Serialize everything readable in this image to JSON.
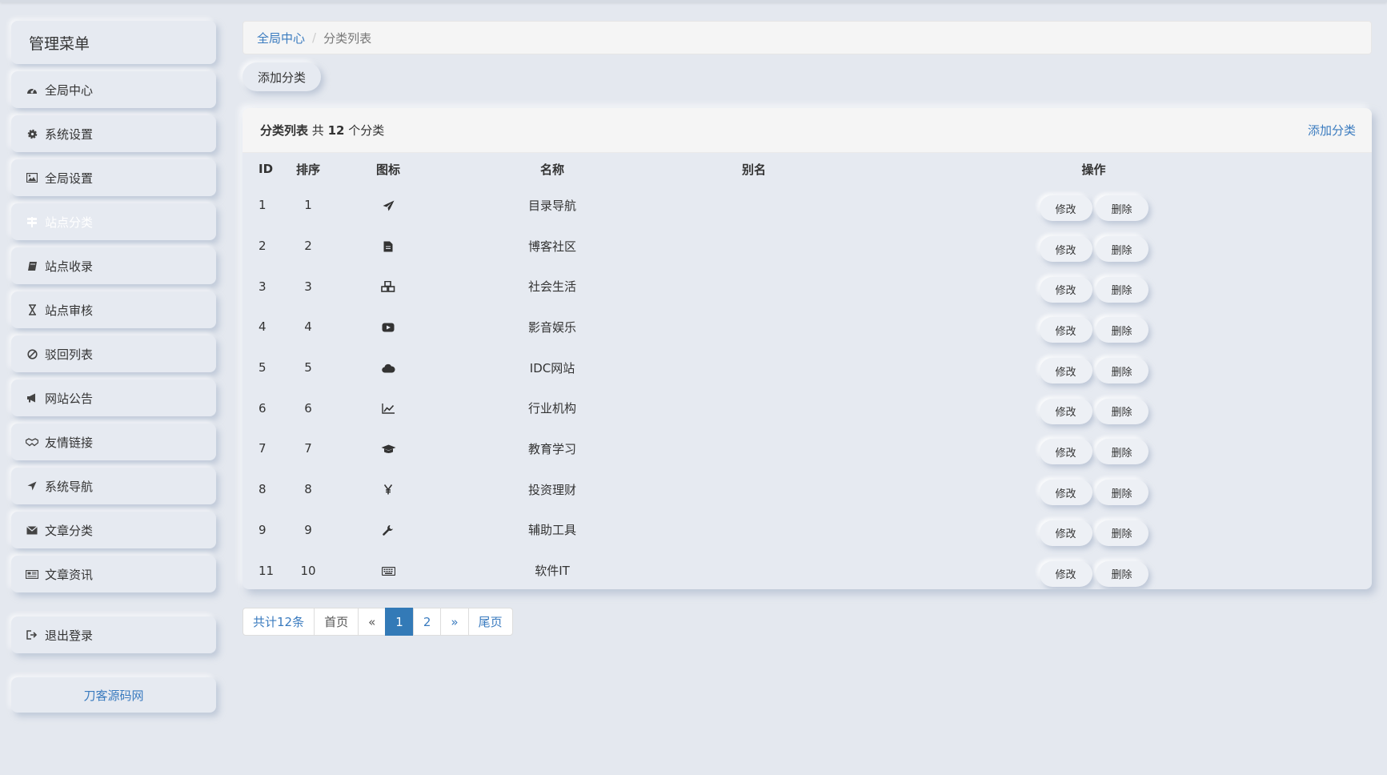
{
  "sidebar": {
    "title": "管理菜单",
    "items": [
      {
        "label": "全局中心",
        "icon": "dashboard-icon"
      },
      {
        "label": "系统设置",
        "icon": "gear-icon"
      },
      {
        "label": "全局设置",
        "icon": "image-icon"
      },
      {
        "label": "站点分类",
        "icon": "signpost-icon"
      },
      {
        "label": "站点收录",
        "icon": "book-icon"
      },
      {
        "label": "站点审核",
        "icon": "hourglass-icon"
      },
      {
        "label": "驳回列表",
        "icon": "ban-icon"
      },
      {
        "label": "网站公告",
        "icon": "bullhorn-icon"
      },
      {
        "label": "友情链接",
        "icon": "handshake-icon"
      },
      {
        "label": "系统导航",
        "icon": "location-arrow-icon"
      },
      {
        "label": "文章分类",
        "icon": "envelope-icon"
      },
      {
        "label": "文章资讯",
        "icon": "newspaper-icon"
      }
    ],
    "logout": "退出登录",
    "footer_link": "刀客源码网"
  },
  "breadcrumb": {
    "home": "全局中心",
    "separator": "/",
    "current": "分类列表"
  },
  "toolbar": {
    "add_label": "添加分类"
  },
  "panel": {
    "title_prefix": "分类列表",
    "title_mid": "共",
    "count": "12",
    "title_suffix": "个分类",
    "add_link": "添加分类"
  },
  "table": {
    "headers": {
      "id": "ID",
      "sort": "排序",
      "icon": "图标",
      "name": "名称",
      "alias": "别名",
      "ops": "操作"
    },
    "edit_label": "修改",
    "delete_label": "删除",
    "rows": [
      {
        "id": "1",
        "sort": "1",
        "icon": "paper-plane-icon",
        "name": "目录导航",
        "alias": ""
      },
      {
        "id": "2",
        "sort": "2",
        "icon": "file-icon",
        "name": "博客社区",
        "alias": ""
      },
      {
        "id": "3",
        "sort": "3",
        "icon": "cubes-icon",
        "name": "社会生活",
        "alias": ""
      },
      {
        "id": "4",
        "sort": "4",
        "icon": "youtube-play-icon",
        "name": "影音娱乐",
        "alias": ""
      },
      {
        "id": "5",
        "sort": "5",
        "icon": "cloud-icon",
        "name": "IDC网站",
        "alias": ""
      },
      {
        "id": "6",
        "sort": "6",
        "icon": "line-chart-icon",
        "name": "行业机构",
        "alias": ""
      },
      {
        "id": "7",
        "sort": "7",
        "icon": "graduation-cap-icon",
        "name": "教育学习",
        "alias": ""
      },
      {
        "id": "8",
        "sort": "8",
        "icon": "yen-icon",
        "name": "投资理财",
        "alias": ""
      },
      {
        "id": "9",
        "sort": "9",
        "icon": "wrench-icon",
        "name": "辅助工具",
        "alias": ""
      },
      {
        "id": "11",
        "sort": "10",
        "icon": "keyboard-icon",
        "name": "软件IT",
        "alias": ""
      }
    ]
  },
  "pagination": {
    "total": "共计12条",
    "first": "首页",
    "prev": "«",
    "pages": [
      "1",
      "2"
    ],
    "current": "1",
    "next": "»",
    "last": "尾页"
  },
  "colors": {
    "background": "#e4e8ef",
    "link": "#3a7bbf",
    "active_page": "#337ab7"
  }
}
